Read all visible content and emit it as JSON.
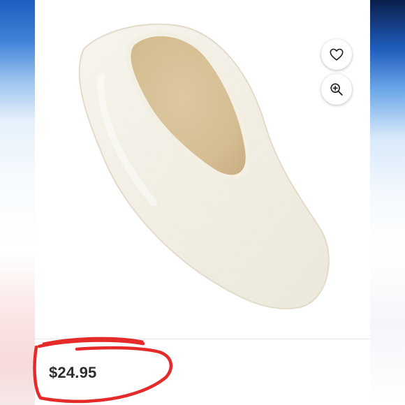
{
  "product": {
    "price": "$24.95",
    "image_subject": "slipper-photo"
  },
  "actions": {
    "favorite_icon": "heart-icon",
    "zoom_icon": "zoom-in-icon"
  },
  "colors": {
    "annotation": "#e52a2a",
    "price_text": "#2e2e2e"
  }
}
